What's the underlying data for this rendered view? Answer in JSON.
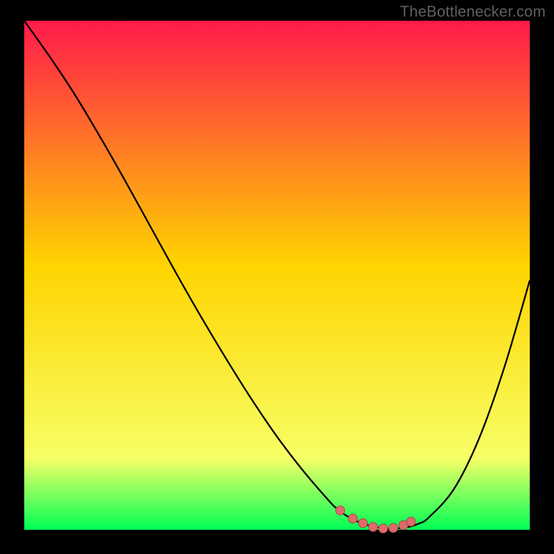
{
  "attribution": "TheBottlenecker.com",
  "colors": {
    "bg": "#000000",
    "gradient_top": "#ff1a4b",
    "gradient_mid": "#ffd400",
    "gradient_low": "#f7ff66",
    "gradient_bottom": "#00ff55",
    "curve": "#000000",
    "marker_fill": "#e06a6a",
    "marker_stroke": "#a54545"
  },
  "plot": {
    "inner_x": 35,
    "inner_y": 30,
    "inner_w": 730,
    "inner_h": 735
  },
  "chart_data": {
    "type": "line",
    "title": "",
    "xlabel": "",
    "ylabel": "",
    "xlim": [
      0,
      100
    ],
    "ylim": [
      0,
      100
    ],
    "x": [
      0,
      5,
      10,
      15,
      20,
      25,
      30,
      35,
      40,
      45,
      50,
      55,
      60,
      62,
      64,
      66,
      68,
      70,
      72,
      74,
      76,
      78,
      80,
      85,
      90,
      95,
      100
    ],
    "values": [
      100,
      93,
      85.5,
      77.2,
      68.5,
      59.5,
      50.5,
      41.8,
      33.5,
      25.6,
      18.3,
      11.8,
      6.0,
      4.0,
      2.6,
      1.6,
      0.9,
      0.45,
      0.2,
      0.3,
      0.55,
      1.2,
      2.4,
      8.0,
      18.0,
      32.0,
      49.0
    ],
    "markers_x": [
      62.5,
      65,
      67,
      69,
      71,
      73,
      75,
      76.5
    ],
    "markers_y": [
      3.8,
      2.2,
      1.3,
      0.55,
      0.25,
      0.35,
      0.9,
      1.6
    ]
  }
}
